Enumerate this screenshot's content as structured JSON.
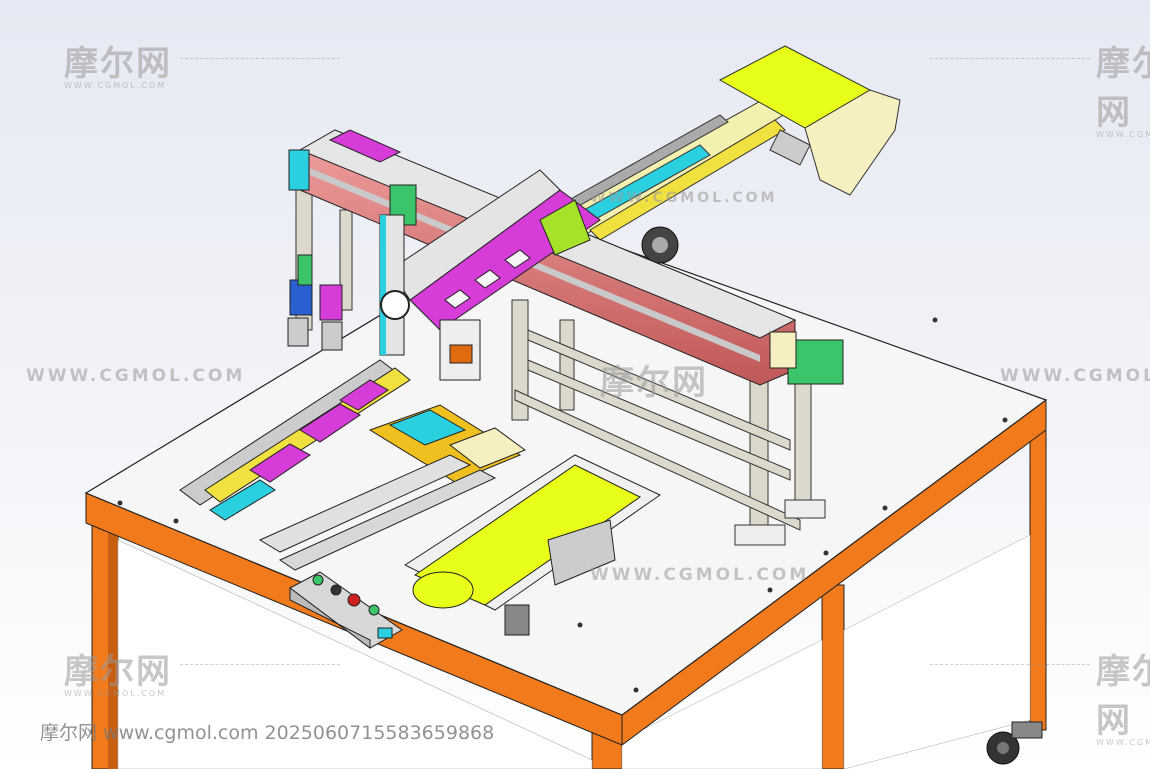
{
  "watermarks": {
    "logo": "摩尔网",
    "logo_sub": "WWW.CGMOL.COM",
    "line": "WWW.CGMOL.COM"
  },
  "footer": {
    "text": "摩尔网 www.cgmol.com 2025060715583659868"
  },
  "colors": {
    "table_frame": "#f07a1c",
    "table_top": "#f4f4f4",
    "gantry_purple": "#d63cd8",
    "rail_red": "#d66a6a",
    "belt_lime": "#e8ff1a",
    "motor_green": "#3cc46a",
    "cyan": "#2ad0e0",
    "yellow": "#f0e040",
    "background_top": "#e9ecf5",
    "background_bottom": "#ffffff"
  }
}
